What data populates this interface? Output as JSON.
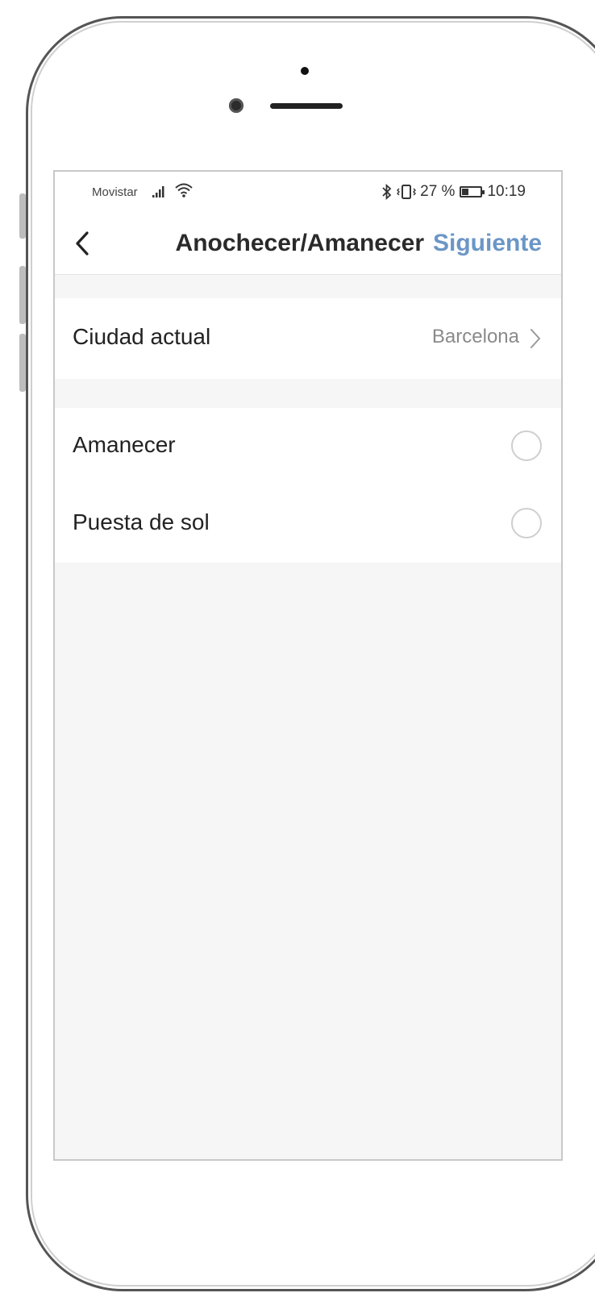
{
  "status_bar": {
    "carrier": "Movistar",
    "battery_percent": "27 %",
    "time": "10:19",
    "icons": [
      "signal-icon",
      "wifi-icon",
      "bluetooth-icon",
      "vibrate-icon",
      "battery-icon"
    ]
  },
  "header": {
    "title": "Anochecer/Amanecer",
    "next_label": "Siguiente",
    "back_icon": "chevron-left-icon",
    "accent_color": "#6b96c6"
  },
  "location": {
    "label": "Ciudad actual",
    "value": "Barcelona"
  },
  "options": [
    {
      "label": "Amanecer",
      "selected": false
    },
    {
      "label": "Puesta de sol",
      "selected": false
    }
  ]
}
